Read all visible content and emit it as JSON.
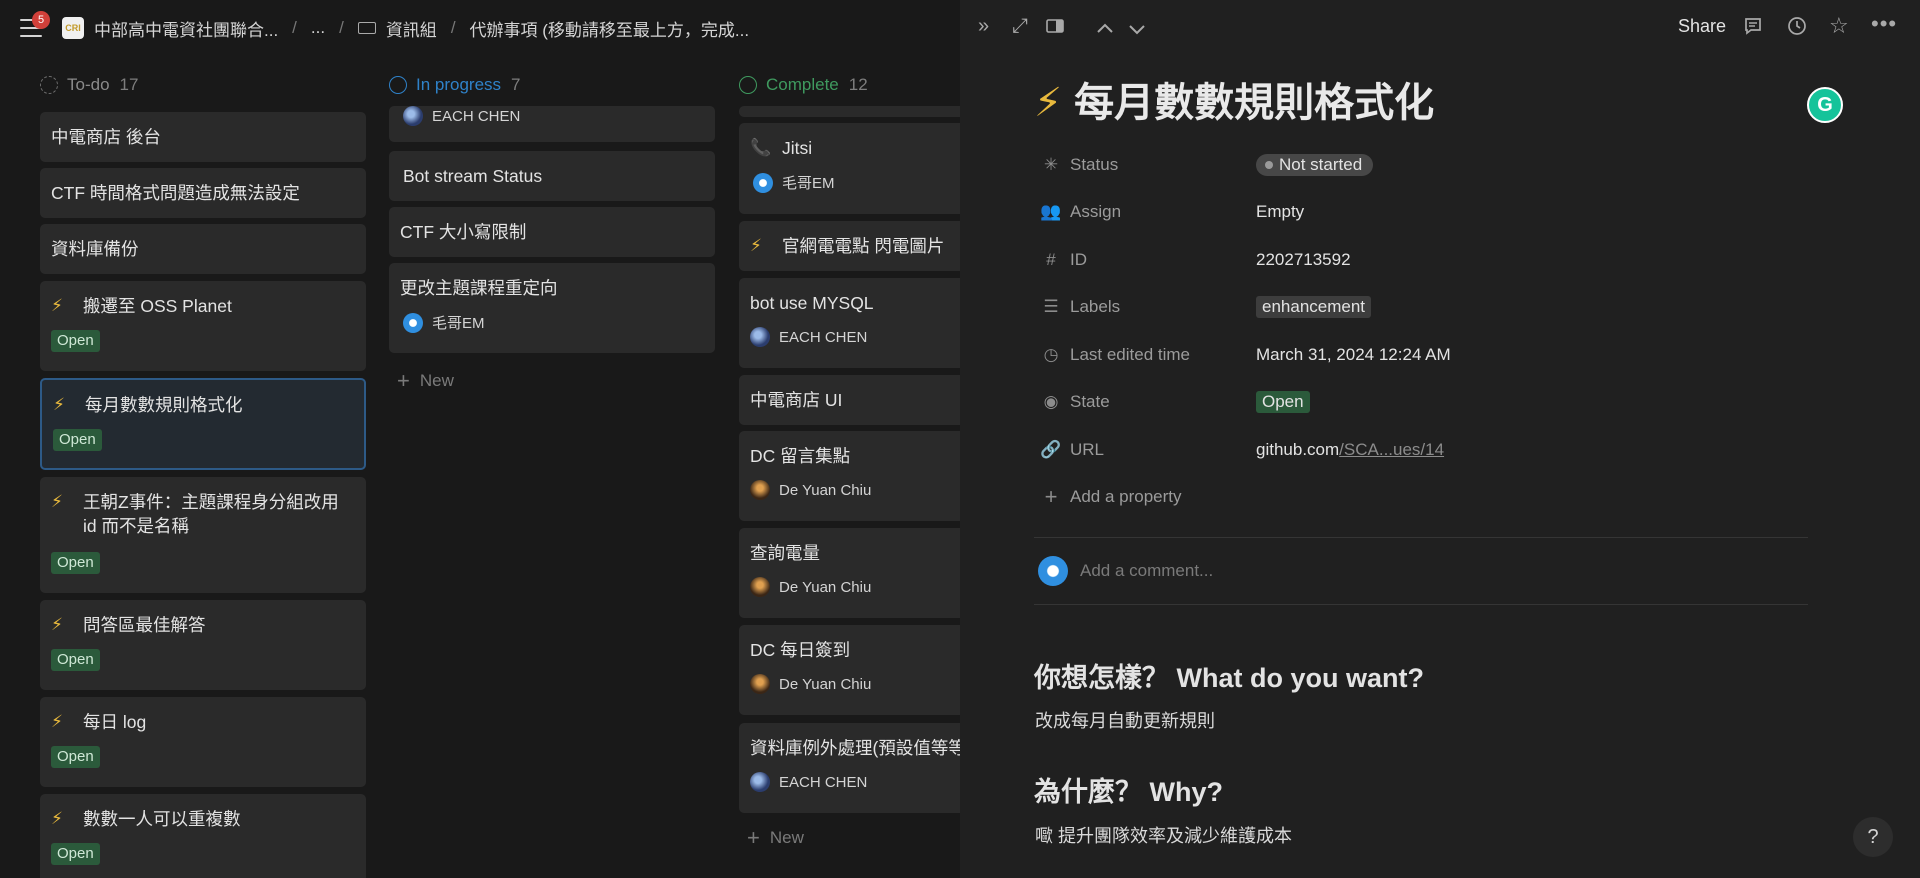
{
  "topbar": {
    "notification_count": "5",
    "workspace_logo": "CRI",
    "breadcrumbs": [
      "中部高中電資社團聯合...",
      "...",
      "資訊組",
      "代辦事項 (移動請移至最上方，完成..."
    ]
  },
  "board": {
    "columns": [
      {
        "name": "To-do",
        "count": "17",
        "cards": [
          {
            "title": "中電商店 後台"
          },
          {
            "title": "CTF 時間格式問題造成無法設定"
          },
          {
            "title": "資料庫備份"
          },
          {
            "title": "搬遷至 OSS Planet",
            "tag": "Open",
            "bolt": "⚡"
          },
          {
            "title": "每月數數規則格式化",
            "tag": "Open",
            "bolt": "⚡"
          },
          {
            "title_line1": "王朝Z事件：主題課程身分組改用",
            "title_line2": "id 而不是名稱",
            "tag": "Open",
            "bolt": "⚡"
          },
          {
            "title": "問答區最佳解答",
            "tag": "Open",
            "bolt": "⚡"
          },
          {
            "title": "每日 log",
            "tag": "Open",
            "bolt": "⚡"
          },
          {
            "title": "數數一人可以重複數",
            "tag": "Open",
            "bolt": "⚡"
          }
        ]
      },
      {
        "name": "In progress",
        "count": "7",
        "cards": [
          {
            "person": "EACH CHEN"
          },
          {
            "title": "Bot stream Status"
          },
          {
            "title": "CTF 大小寫限制"
          },
          {
            "title": "更改主題課程重定向",
            "person": "毛哥EM"
          }
        ],
        "new_label": "New"
      },
      {
        "name": "Complete",
        "count": "12",
        "cards": [
          {
            "title": "Jitsi",
            "person": "毛哥EM",
            "icon": "📞"
          },
          {
            "title": "官網電電點 閃電圖片",
            "bolt": "⚡"
          },
          {
            "title": "bot use MYSQL",
            "person": "EACH CHEN"
          },
          {
            "title": "中電商店 UI"
          },
          {
            "title": "DC 留言集點",
            "person": "De Yuan Chiu"
          },
          {
            "title": "查詢電量",
            "person": "De Yuan Chiu"
          },
          {
            "title": "DC 每日簽到",
            "person": "De Yuan Chiu"
          },
          {
            "title": "資料庫例外處理(預設值等等",
            "person": "EACH CHEN"
          }
        ],
        "new_label": "New"
      }
    ]
  },
  "panel": {
    "share_label": "Share",
    "title_icon": "⚡",
    "title": "每月數數規則格式化",
    "properties": {
      "status": {
        "name": "Status",
        "value": "Not started"
      },
      "assign": {
        "name": "Assign",
        "value": "Empty"
      },
      "id": {
        "name": "ID",
        "value": "2202713592"
      },
      "labels": {
        "name": "Labels",
        "value": "enhancement"
      },
      "last_edited": {
        "name": "Last edited time",
        "value": "March 31, 2024 12:24 AM"
      },
      "state": {
        "name": "State",
        "value": "Open"
      },
      "url": {
        "name": "URL",
        "value_main": "github.com",
        "value_rest": "/SCA...ues/14"
      }
    },
    "add_property": "Add a property",
    "comment_placeholder": "Add a comment...",
    "body": {
      "h_what": "你想怎樣？ What do you want?",
      "p_what": "改成每月自動更新規則",
      "h_why": "為什麼？ Why?",
      "p_why": "𡂿 提升團隊效率及減少維護成本"
    },
    "help_label": "?"
  },
  "colors": {
    "background": "#191919",
    "panel_background": "#202020",
    "card_background": "#2a2a2a",
    "open_tag": "#2b5a3b",
    "in_progress_blue": "#2f82c9",
    "complete_green": "#3f9a5f",
    "selected_border": "#2d5a87"
  }
}
